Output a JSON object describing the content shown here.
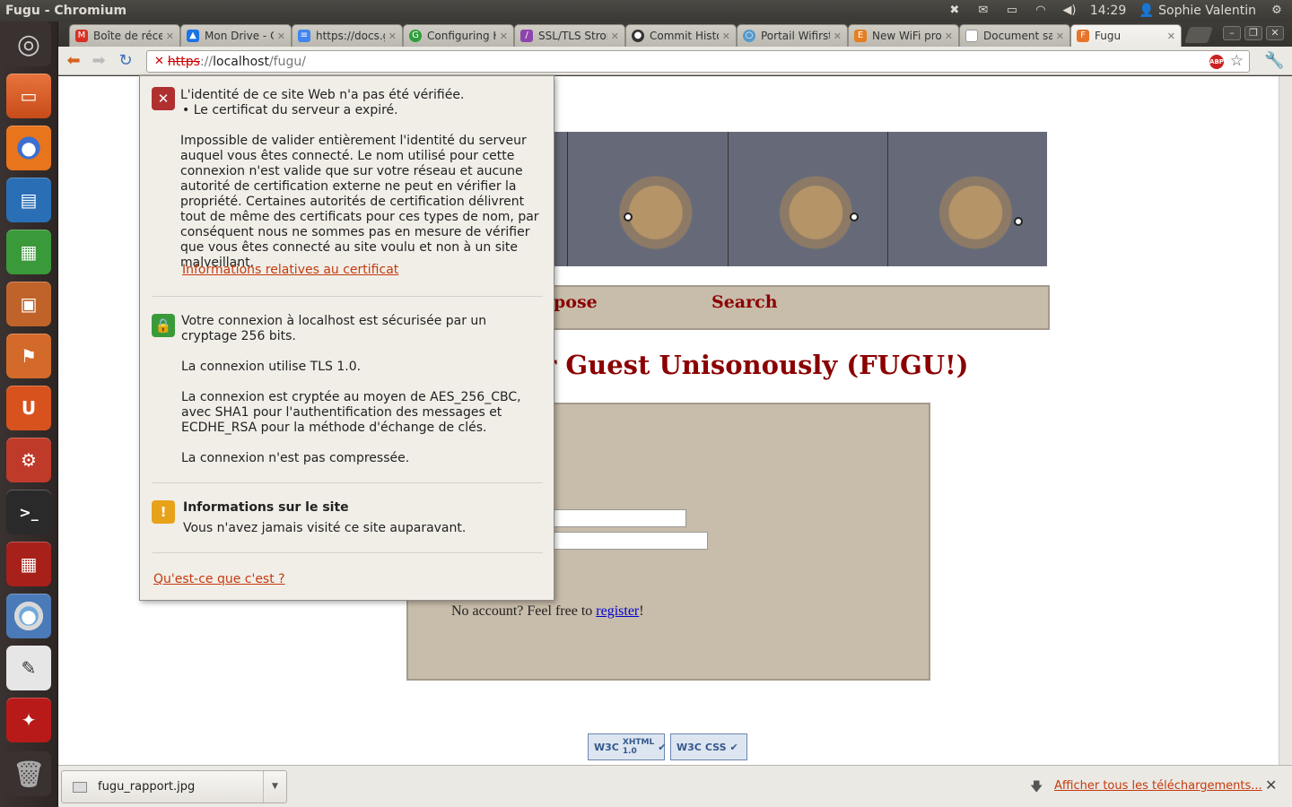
{
  "panel": {
    "window_title": "Fugu - Chromium",
    "clock": "14:29",
    "user": "Sophie Valentin"
  },
  "tabs": [
    {
      "label": "Boîte de réce",
      "icon": "gmail-icon",
      "color": "#d93025"
    },
    {
      "label": "Mon Drive - C",
      "icon": "drive-icon",
      "color": "#1a73e8"
    },
    {
      "label": "https://docs.g",
      "icon": "docs-icon",
      "color": "#4285f4"
    },
    {
      "label": "Configuring H",
      "icon": "green-icon",
      "color": "#2e9e3a"
    },
    {
      "label": "SSL/TLS Stron",
      "icon": "feather-icon",
      "color": "#8e44ad"
    },
    {
      "label": "Commit Histo",
      "icon": "github-icon",
      "color": "#333333"
    },
    {
      "label": "Portail Wifirst",
      "icon": "wifi-icon",
      "color": "#5599cc"
    },
    {
      "label": "New WiFi pro",
      "icon": "e-icon",
      "color": "#e67e22"
    },
    {
      "label": "Document sa",
      "icon": "page-icon",
      "color": "#999999"
    },
    {
      "label": "Fugu",
      "icon": "fugu-icon",
      "color": "#e8742a"
    }
  ],
  "address": {
    "scheme": "https",
    "separator": "://",
    "host": "localhost",
    "path": "/fugu/"
  },
  "popup": {
    "identity_title": "L'identité de ce site Web n'a pas été vérifiée.",
    "identity_bullet": "• Le certificat du serveur a expiré.",
    "identity_body": "Impossible de valider entièrement l'identité du serveur auquel vous êtes connecté. Le nom utilisé pour cette connexion n'est valide que sur votre réseau et aucune autorité de certification externe ne peut en vérifier la propriété. Certaines autorités de certification délivrent tout de même des certificats pour ces types de nom, par conséquent nous ne sommes pas en mesure de vérifier que vous êtes connecté au site voulu et non à un site malveillant.",
    "cert_link": "Informations relatives au certificat",
    "conn_secure": "Votre connexion à localhost est sécurisée par un cryptage 256 bits.",
    "conn_tls": "La connexion utilise TLS 1.0.",
    "conn_cipher": "La connexion est cryptée au moyen de AES_256_CBC, avec SHA1 pour l'authentification des messages et ECDHE_RSA pour la méthode d'échange de clés.",
    "conn_compress": "La connexion n'est pas compressée.",
    "site_title": "Informations sur le site",
    "site_body": "Vous n'avez jamais visité ce site auparavant.",
    "help_link": "Qu'est-ce que c'est ?"
  },
  "site": {
    "nav_propose": "pose",
    "nav_search": "Search",
    "title": "r Guest Unisonously (FUGU!)",
    "no_account_prefix": "No account? Feel free to ",
    "register_link": "register",
    "no_account_suffix": "!",
    "badge_xhtml": "XHTML 1.0",
    "badge_css": "CSS",
    "badge_w3c": "W3C"
  },
  "downloads": {
    "file": "fugu_rapport.jpg",
    "show_all": "Afficher tous les téléchargements..."
  },
  "colors": {
    "site_accent": "#8b0000",
    "link_orange": "#c43a0e"
  }
}
